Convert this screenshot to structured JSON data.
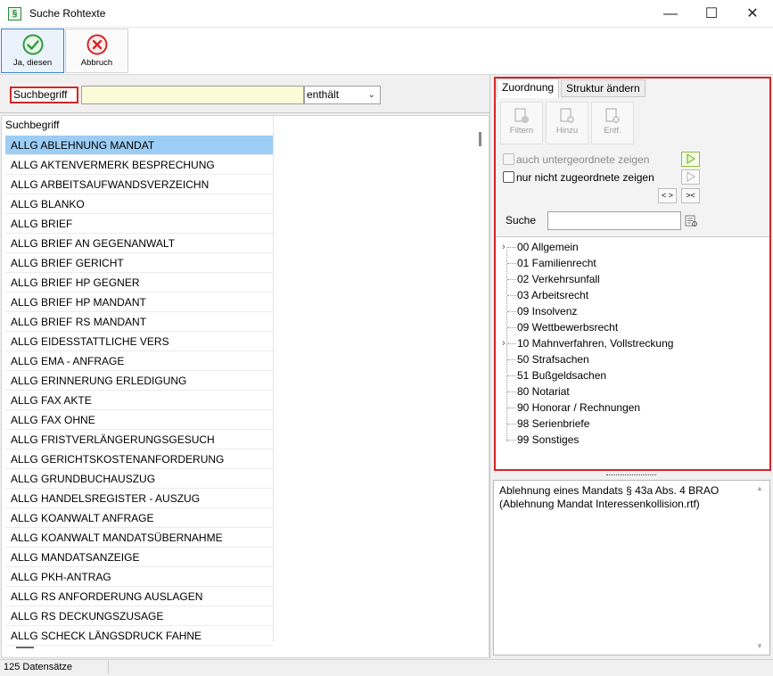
{
  "window": {
    "title": "Suche Rohtexte",
    "icon_glyph": "§"
  },
  "window_controls": {
    "minimize": "—",
    "maximize": "☐",
    "close": "✕"
  },
  "toolbar": {
    "yes_label": "Ja, diesen",
    "cancel_label": "Abbruch",
    "yes_color": "#2e9a3a",
    "cancel_color": "#d32626"
  },
  "search": {
    "label": "Suchbegriff",
    "value": "",
    "mode": "enthält"
  },
  "list": {
    "header": "Suchbegriff",
    "items": [
      "ALLG ABLEHNUNG MANDAT",
      "ALLG AKTENVERMERK BESPRECHUNG",
      "ALLG ARBEITSAUFWANDSVERZEICHN",
      "ALLG BLANKO",
      "ALLG BRIEF",
      "ALLG BRIEF AN GEGENANWALT",
      "ALLG BRIEF GERICHT",
      "ALLG BRIEF HP GEGNER",
      "ALLG BRIEF HP MANDANT",
      "ALLG BRIEF RS MANDANT",
      "ALLG EIDESSTATTLICHE VERS",
      "ALLG EMA - ANFRAGE",
      "ALLG ERINNERUNG ERLEDIGUNG",
      "ALLG FAX AKTE",
      "ALLG FAX OHNE",
      "ALLG FRISTVERLÄNGERUNGSGESUCH",
      "ALLG GERICHTSKOSTENANFORDERUNG",
      "ALLG GRUNDBUCHAUSZUG",
      "ALLG HANDELSREGISTER - AUSZUG",
      "ALLG KOANWALT ANFRAGE",
      "ALLG KOANWALT MANDATSÜBERNAHME",
      "ALLG MANDATSANZEIGE",
      "ALLG PKH-ANTRAG",
      "ALLG RS ANFORDERUNG AUSLAGEN",
      "ALLG RS DECKUNGSZUSAGE",
      "ALLG SCHECK LÄNGSDRUCK FAHNE"
    ],
    "selected_index": 0,
    "selection_color": "#9ccdf5"
  },
  "status": {
    "record_count": "125 Datensätze"
  },
  "assign": {
    "tabs": [
      "Zuordnung",
      "Struktur ändern"
    ],
    "active_tab": 0,
    "filter_label": "Filtern",
    "add_label": "Hinzu",
    "remove_label": "Entf.",
    "include_sub_label": "auch untergeordnete zeigen",
    "unassigned_label": "nur nicht zugeordnete zeigen",
    "expand_label": "< >",
    "collapse_label": "><",
    "search_label": "Suche",
    "search_value": "",
    "tree": [
      {
        "label": "00 Allgemein",
        "expandable": true
      },
      {
        "label": "01 Familienrecht",
        "expandable": false
      },
      {
        "label": "02 Verkehrsunfall",
        "expandable": false
      },
      {
        "label": "03 Arbeitsrecht",
        "expandable": false
      },
      {
        "label": "09 Insolvenz",
        "expandable": false
      },
      {
        "label": "09 Wettbewerbsrecht",
        "expandable": false
      },
      {
        "label": "10 Mahnverfahren, Vollstreckung",
        "expandable": true
      },
      {
        "label": "50 Strafsachen",
        "expandable": false
      },
      {
        "label": "51 Bußgeldsachen",
        "expandable": false
      },
      {
        "label": "80 Notariat",
        "expandable": false
      },
      {
        "label": "90 Honorar / Rechnungen",
        "expandable": false
      },
      {
        "label": "98 Serienbriefe",
        "expandable": false
      },
      {
        "label": "99 Sonstiges",
        "expandable": false
      }
    ]
  },
  "description": {
    "text": "Ablehnung eines Mandats § 43a Abs. 4 BRAO\n(Ablehnung Mandat Interessenkollision.rtf)"
  }
}
